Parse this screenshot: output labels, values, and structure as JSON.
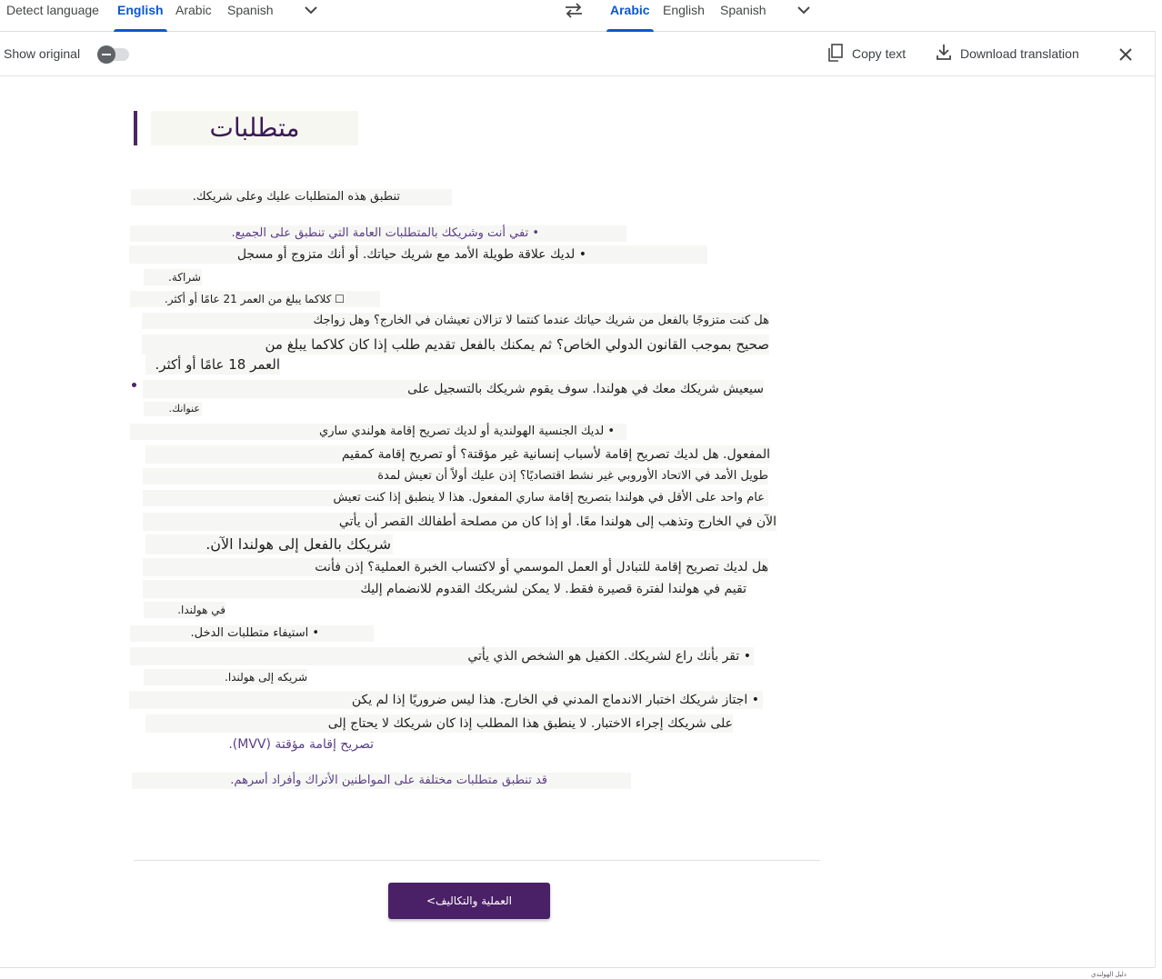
{
  "source_langs": [
    "Detect language",
    "English",
    "Arabic",
    "Spanish"
  ],
  "target_langs": [
    "Arabic",
    "English",
    "Spanish"
  ],
  "toolbar": {
    "show_original": "Show original",
    "copy_text": "Copy text",
    "download": "Download translation"
  },
  "doc": {
    "title": "متطلبات",
    "lines": [
      "تنطبق هذه المتطلبات عليك وعلى شريكك.",
      "• تفي أنت وشريكك بالمتطلبات العامة التي تنطبق على الجميع.",
      "• لديك علاقة طويلة الأمد مع شريك حياتك. أو أنك متزوج أو مسجل",
      "شراكة.",
      "☐ كلاكما يبلغ من العمر 21 عامًا أو أكثر.",
      "هل كنت متزوجًا بالفعل من شريك حياتك عندما كنتما لا تزالان تعيشان في الخارج؟ وهل زواجك",
      "صحيح بموجب القانون الدولي الخاص؟ ثم يمكنك بالفعل تقديم طلب إذا كان كلاكما يبلغ من",
      "العمر 18 عامًا أو أكثر.",
      "سيعيش شريكك معك في هولندا. سوف يقوم شريكك بالتسجيل على",
      "عنوانك.",
      "• لديك الجنسية الهولندية أو لديك تصريح إقامة هولندي ساري",
      "المفعول. هل لديك تصريح إقامة لأسباب إنسانية غير مؤقتة؟ أو تصريح إقامة كمقيم",
      "طويل الأمد في الاتحاد الأوروبي غير نشط اقتصاديًا؟ إذن عليك أولاً أن تعيش لمدة",
      "عام واحد على الأقل في هولندا بتصريح إقامة ساري المفعول. هذا لا ينطبق إذا كنت تعيش",
      "الآن في الخارج وتذهب إلى هولندا معًا. أو إذا كان من مصلحة أطفالك القصر أن يأتي",
      "شريكك بالفعل إلى هولندا الآن.",
      "هل لديك تصريح إقامة للتبادل أو العمل الموسمي أو لاكتساب الخبرة العملية؟ إذن فأنت",
      "تقيم في هولندا لفترة قصيرة فقط. لا يمكن لشريكك القدوم للانضمام إليك",
      "في هولندا.",
      "• استيفاء متطلبات الدخل.",
      "• تقر بأنك راع لشريكك. الكفيل هو الشخص الذي يأتي",
      "شريكه إلى هولندا.",
      "• اجتاز شريكك اختبار الاندماج المدني في الخارج. هذا ليس ضروريًا إذا لم يكن",
      "على شريكك إجراء الاختبار. لا ينطبق هذا المطلب إذا كان شريكك لا يحتاج إلى",
      "تصريح إقامة مؤقتة (MVV).",
      "قد تنطبق متطلبات مختلفة على المواطنين الأتراك وأفراد أسرهم."
    ],
    "cta": "العملية والتكاليف>",
    "footer_note": "دليل الهولندي"
  },
  "colors": {
    "accent": "#0b57d0",
    "doc_purple": "#4a2066"
  }
}
